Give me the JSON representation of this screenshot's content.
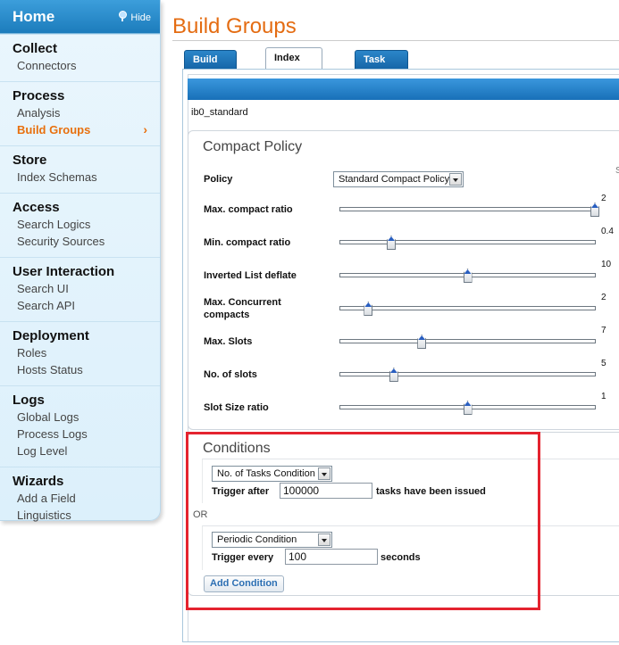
{
  "sidebar": {
    "home": "Home",
    "hide": "Hide",
    "sections": [
      {
        "title": "Collect",
        "items": [
          "Connectors"
        ]
      },
      {
        "title": "Process",
        "items": [
          "Analysis",
          "Build Groups"
        ]
      },
      {
        "title": "Store",
        "items": [
          "Index Schemas"
        ]
      },
      {
        "title": "Access",
        "items": [
          "Search Logics",
          "Security Sources"
        ]
      },
      {
        "title": "User Interaction",
        "items": [
          "Search UI",
          "Search API"
        ]
      },
      {
        "title": "Deployment",
        "items": [
          "Roles",
          "Hosts Status"
        ]
      },
      {
        "title": "Logs",
        "items": [
          "Global Logs",
          "Process Logs",
          "Log Level"
        ]
      },
      {
        "title": "Wizards",
        "items": [
          "Add a Field",
          "Linguistics"
        ]
      }
    ],
    "active_item": "Build Groups"
  },
  "page": {
    "title": "Build Groups",
    "tabs": [
      "Build Groups",
      "Index Builders",
      "Task Queues"
    ],
    "active_tab": "Index Builders",
    "builder_name": "ib0_standard"
  },
  "compact_policy": {
    "title": "Compact Policy",
    "policy_label": "Policy",
    "policy_value": "Standard Compact Policy",
    "sliders": [
      {
        "label": "Max. compact ratio",
        "value": "2",
        "fraction": 1.0
      },
      {
        "label": "Min. compact ratio",
        "value": "0.4",
        "fraction": 0.2
      },
      {
        "label": "Inverted List deflate",
        "value": "10",
        "fraction": 0.5
      },
      {
        "label": "Max. Concurrent compacts",
        "value": "2",
        "fraction": 0.11
      },
      {
        "label": "Max. Slots",
        "value": "7",
        "fraction": 0.32
      },
      {
        "label": "No. of slots",
        "value": "5",
        "fraction": 0.21
      },
      {
        "label": "Slot Size ratio",
        "value": "1",
        "fraction": 0.5
      }
    ]
  },
  "conditions": {
    "title": "Conditions",
    "or_label": "OR",
    "items": [
      {
        "type": "No. of Tasks Condition",
        "prefix": "Trigger after",
        "value": "100000",
        "suffix": "tasks have been issued"
      },
      {
        "type": "Periodic Condition",
        "prefix": "Trigger every",
        "value": "100",
        "suffix": "seconds"
      }
    ],
    "add_label": "Add Condition"
  },
  "colors": {
    "accent": "#e46c12",
    "tab_blue": "#1d76bd",
    "highlight": "#e4232f"
  }
}
